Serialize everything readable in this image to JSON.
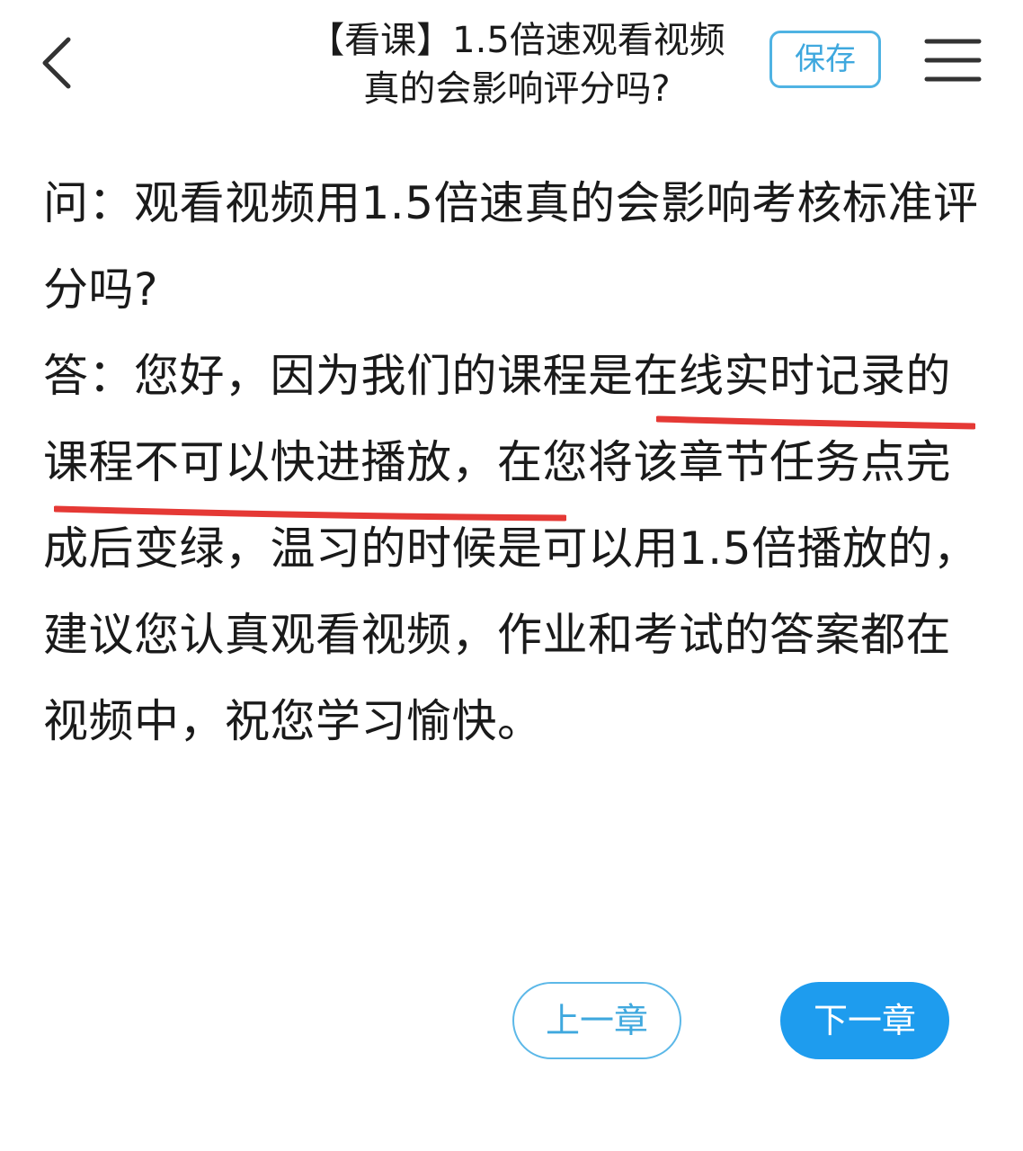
{
  "header": {
    "back_icon": "chevron-left-icon",
    "title": "【看课】1.5倍速观看视频真的会影响评分吗?",
    "save_label": "保存",
    "menu_icon": "hamburger-menu-icon"
  },
  "article": {
    "question": "问：观看视频用1.5倍速真的会影响考核标准评分吗?",
    "answer": "答：您好，因为我们的课程是在线实时记录的课程不可以快进播放，在您将该章节任务点完成后变绿，温习的时候是可以用1.5倍播放的，建议您认真观看视频，作业和考试的答案都在视频中，祝您学习愉快。"
  },
  "nav": {
    "prev_label": "上一章",
    "next_label": "下一章"
  },
  "colors": {
    "accent": "#1e9cee",
    "accent_light": "#4fb3e3",
    "underline": "#e53935",
    "text": "#1a1a1a"
  }
}
